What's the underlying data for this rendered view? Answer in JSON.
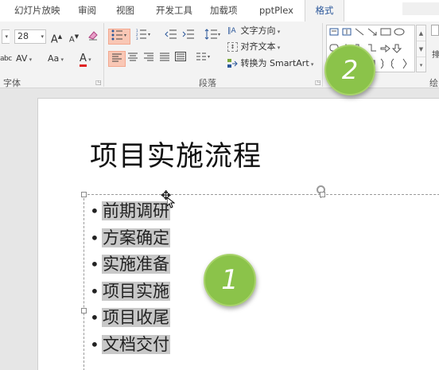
{
  "tabs": [
    "幻灯片放映",
    "审阅",
    "视图",
    "开发工具",
    "加载项",
    "pptPlex",
    "格式"
  ],
  "active_tab": "格式",
  "font_group": {
    "label": "字体",
    "font_size": "28",
    "grow_font": "A",
    "shrink_font": "A",
    "char_spacing": "AV",
    "change_case": "Aa",
    "font_color": "A",
    "strike_text": "abc"
  },
  "paragraph_group": {
    "label": "段落",
    "text_direction": "文字方向",
    "align_text": "对齐文本",
    "convert_smartart": "转换为 SmartArt"
  },
  "drawing_group": {
    "label": "绘",
    "extra": "排"
  },
  "slide": {
    "title": "项目实施流程",
    "bullets": [
      "前期调研",
      "方案确定",
      "实施准备",
      "项目实施",
      "项目收尾",
      "文档交付"
    ]
  },
  "badges": {
    "one": "1",
    "two": "2"
  },
  "colors": {
    "badge_green": "#8bc34a",
    "highlight": "#f9c7b5",
    "text_highlight": "#c8c8c8",
    "font_color_red": "#e02020"
  }
}
